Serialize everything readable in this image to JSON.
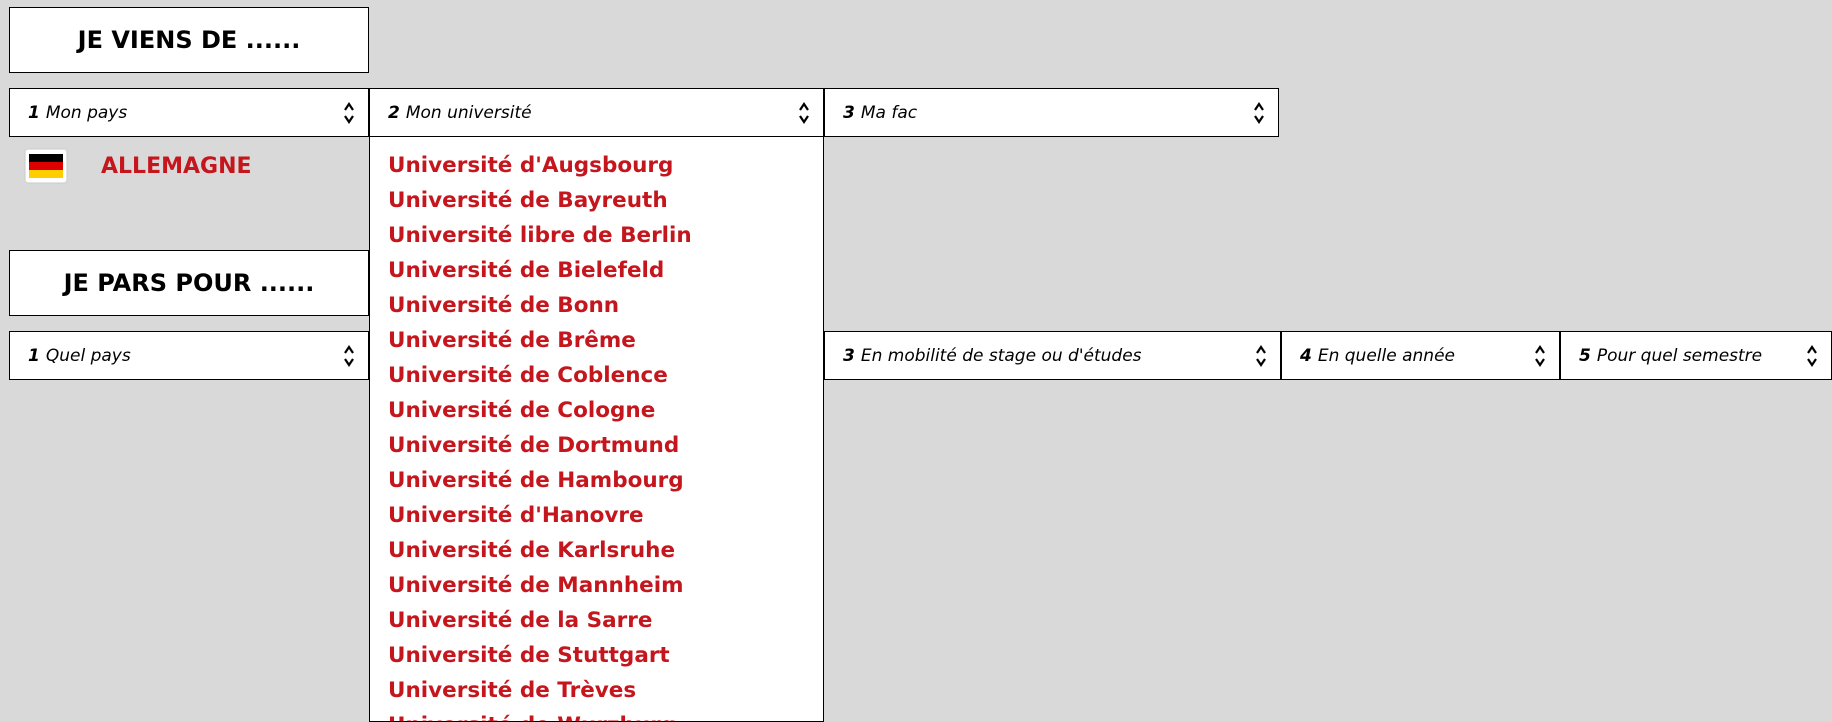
{
  "from_section": {
    "title": "JE VIENS DE ......"
  },
  "to_section": {
    "title": "JE PARS POUR ......"
  },
  "fields": {
    "country": {
      "num": "1",
      "label": "Mon pays"
    },
    "university": {
      "num": "2",
      "label": "Mon université"
    },
    "faculty": {
      "num": "3",
      "label": "Ma fac"
    },
    "dest_country": {
      "num": "1",
      "label": "Quel pays"
    },
    "mobility": {
      "num": "3",
      "label": "En mobilité de stage ou d'études"
    },
    "year": {
      "num": "4",
      "label": "En quelle année"
    },
    "semester": {
      "num": "5",
      "label": "Pour quel semestre"
    }
  },
  "selected_country": {
    "name": "ALLEMAGNE",
    "flag_colors": [
      "#000000",
      "#dd0000",
      "#ffce00"
    ]
  },
  "university_list": [
    "Université d'Augsbourg",
    "Université de Bayreuth",
    "Université libre de Berlin",
    "Université de Bielefeld",
    "Université de Bonn",
    "Université de Brême",
    "Université de Coblence",
    "Université de Cologne",
    "Université de Dortmund",
    "Université de Hambourg",
    "Université d'Hanovre",
    "Université de Karlsruhe",
    "Université de Mannheim",
    "Université de la Sarre",
    "Université de Stuttgart",
    "Université de Trèves",
    "Université de Wurzburg"
  ],
  "colors": {
    "accent": "#c4161c",
    "background": "#d9d9d9"
  }
}
